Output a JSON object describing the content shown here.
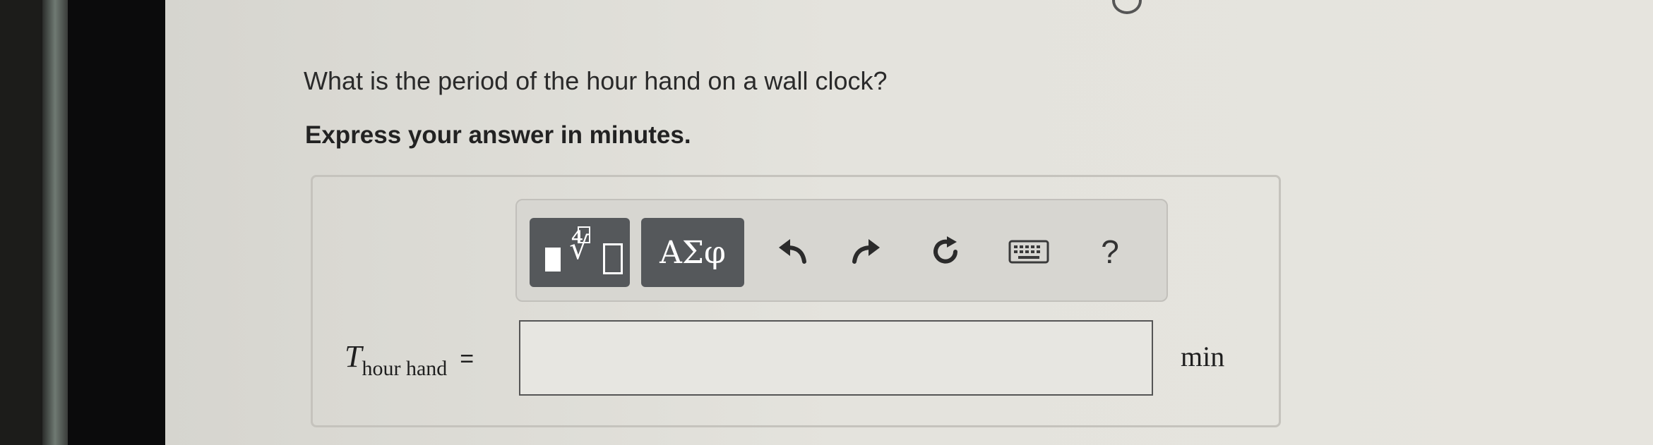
{
  "question": {
    "text": "What is the period of the hour hand on a wall clock?",
    "instruction": "Express your answer in minutes."
  },
  "toolbar": {
    "greek_label": "ΑΣφ",
    "help_label": "?",
    "icons": [
      "templates-icon",
      "greek-letters",
      "undo-icon",
      "redo-icon",
      "reset-icon",
      "keyboard-icon",
      "help-icon"
    ],
    "button_color": "#55585b"
  },
  "answer": {
    "variable": "T",
    "subscript": "hour hand",
    "equals": "=",
    "value": "",
    "unit": "min"
  }
}
